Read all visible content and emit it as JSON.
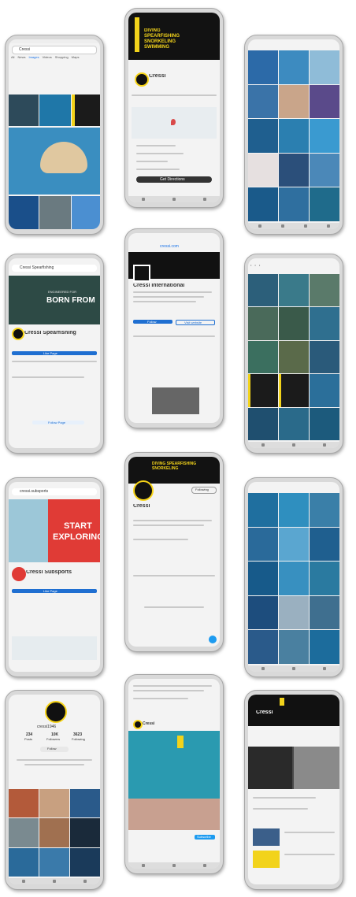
{
  "p1": {
    "search": "Cressi",
    "tabs": [
      "All",
      "News",
      "Images",
      "Videos",
      "Shopping",
      "Maps"
    ]
  },
  "p2": {
    "banner": "DIVING SPEARFISHING SNORKELING SWIMMING",
    "name": "Cressi",
    "btn": "Get Directions"
  },
  "p4": {
    "search": "Cressi Spearfishing",
    "banner": "BORN FROM",
    "banner_small": "ENGINEERED FOR",
    "name": "Cressi Spearfishing",
    "btn": "Like Page",
    "btn2": "Follow Page"
  },
  "p5": {
    "link": "cressi.com",
    "name": "Cressi International",
    "btn": "Follow",
    "btn2": "Visit website"
  },
  "p7": {
    "search": "cressi.subsports",
    "banner": "START",
    "banner2": "EXPLORING",
    "name": "Cressi Subsports",
    "btn": "Like Page"
  },
  "p8": {
    "banner": "DIVING SPEARFISHING SNORKELING",
    "name": "Cressi",
    "follow": "Following"
  },
  "p10": {
    "handle": "cressi1946",
    "stats": [
      "234",
      "10K",
      "3623"
    ],
    "stat_labels": [
      "Posts",
      "Followers",
      "Following"
    ],
    "btn": "Follow"
  },
  "p11": {
    "name": "Cressi",
    "btn": "Subscribe"
  },
  "p12": {
    "name": "Cressi"
  }
}
